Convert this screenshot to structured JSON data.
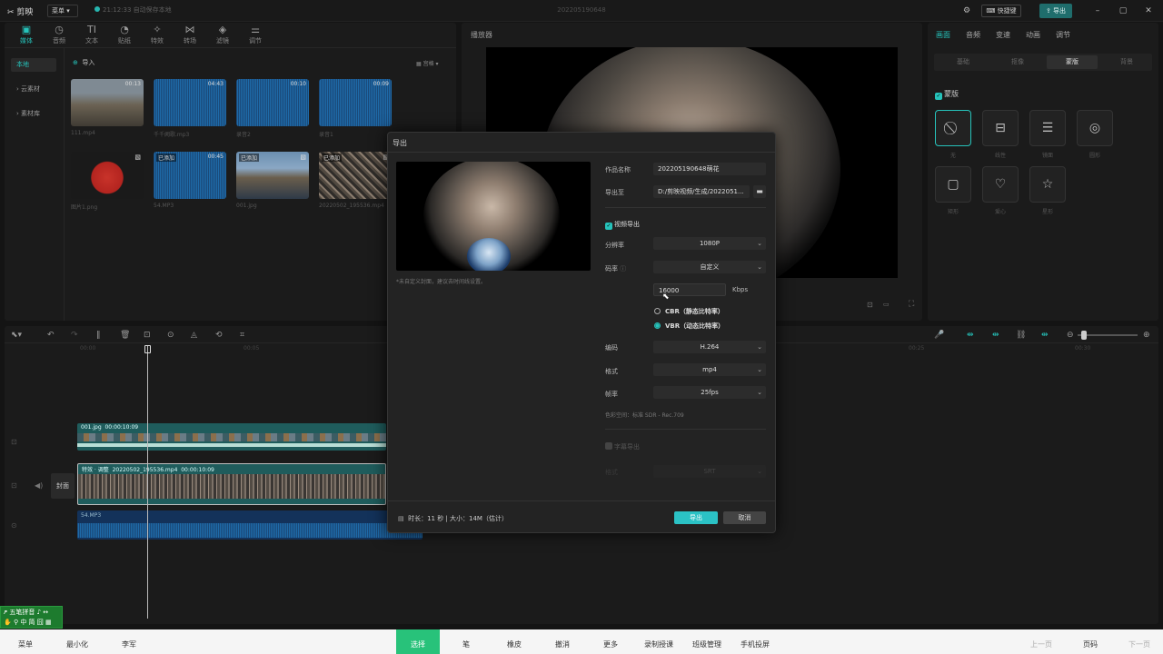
{
  "app": {
    "logo": "剪映",
    "menu": "菜单",
    "autosave": "21:12:33 自动保存本地",
    "project_title": "202205190648",
    "shortcut": "快捷键",
    "export": "导出"
  },
  "toolbar": [
    {
      "label": "媒体",
      "icon": "media-icon",
      "glyph": "▣"
    },
    {
      "label": "音频",
      "icon": "audio-icon",
      "glyph": "◷"
    },
    {
      "label": "文本",
      "icon": "text-icon",
      "glyph": "TI"
    },
    {
      "label": "贴纸",
      "icon": "sticker-icon",
      "glyph": "◔"
    },
    {
      "label": "特效",
      "icon": "effects-icon",
      "glyph": "✧"
    },
    {
      "label": "转场",
      "icon": "transition-icon",
      "glyph": "⋈"
    },
    {
      "label": "滤镜",
      "icon": "filter-icon",
      "glyph": "◈"
    },
    {
      "label": "调节",
      "icon": "adjust-icon",
      "glyph": "⚌"
    }
  ],
  "media_sidebar": [
    "本地",
    "› 云素材",
    "› 素材库"
  ],
  "media": {
    "import": "导入",
    "view": "宫格"
  },
  "media_items": [
    {
      "caption": "111.mp4",
      "duration": "00:13",
      "tag": "",
      "kind": "video"
    },
    {
      "caption": "千千阙歌.mp3",
      "duration": "04:43",
      "tag": "",
      "kind": "audio"
    },
    {
      "caption": "录音2",
      "duration": "00:10",
      "tag": "",
      "kind": "audio"
    },
    {
      "caption": "录音1",
      "duration": "00:09",
      "tag": "",
      "kind": "audio"
    },
    {
      "caption": "图片1.png",
      "duration": "",
      "tag": "",
      "kind": "drum"
    },
    {
      "caption": "54.MP3",
      "duration": "00:45",
      "tag": "已添加",
      "kind": "audio"
    },
    {
      "caption": "001.jpg",
      "duration": "",
      "tag": "已添加",
      "kind": "photo"
    },
    {
      "caption": "20220502_195536.mp4",
      "duration": "",
      "tag": "已添加",
      "kind": "crystal"
    }
  ],
  "player": {
    "title": "播放器"
  },
  "right_panel": {
    "tabs": [
      "画面",
      "音频",
      "变速",
      "动画",
      "调节"
    ],
    "segments": [
      "基础",
      "抠像",
      "蒙版",
      "背景"
    ],
    "mask_title": "蒙版",
    "masks": [
      {
        "label": "无",
        "glyph": "⃠",
        "icon": "none-icon"
      },
      {
        "label": "线性",
        "glyph": "⊟",
        "icon": "linear-mask-icon"
      },
      {
        "label": "镜面",
        "glyph": "☰",
        "icon": "mirror-mask-icon"
      },
      {
        "label": "圆形",
        "glyph": "◎",
        "icon": "circle-mask-icon"
      },
      {
        "label": "矩形",
        "glyph": "▢",
        "icon": "rectangle-mask-icon"
      },
      {
        "label": "爱心",
        "glyph": "♡",
        "icon": "heart-mask-icon"
      },
      {
        "label": "星形",
        "glyph": "☆",
        "icon": "star-mask-icon"
      }
    ]
  },
  "timeline": {
    "ruler": [
      "00:00",
      "00:05",
      "00:25",
      "00:30"
    ],
    "clip1": {
      "name": "001.jpg",
      "duration": "00:00:10:09"
    },
    "clip2": {
      "name": "特效 · 调整",
      "file": "20220502_195536.mp4",
      "duration": "00:00:10:09"
    },
    "cover": "封面",
    "audio_clip": "54.MP3"
  },
  "export_dialog": {
    "title": "导出",
    "cover_note": "*未自定义封面，建议去时间线设置。",
    "name_label": "作品名称",
    "name_value": "202205190648萌花",
    "path_label": "导出至",
    "path_value": "D:/剪映视频/生成/2022051...",
    "video_export": "视频导出",
    "resolution_label": "分辨率",
    "resolution_value": "1080P",
    "bitrate_label": "码率",
    "bitrate_value": "自定义",
    "bitrate_input": "16000",
    "bitrate_unit": "Kbps",
    "cbr_label": "CBR（静态比特率）",
    "vbr_label": "VBR（动态比特率）",
    "codec_label": "编码",
    "codec_value": "H.264",
    "format_label": "格式",
    "format_value": "mp4",
    "framerate_label": "帧率",
    "framerate_value": "25fps",
    "color_space": "色彩空间：标准 SDR - Rec.709",
    "subtitle_export": "字幕导出",
    "subtitle_format_label": "格式",
    "subtitle_format_value": "SRT",
    "info": "时长：11 秒 | 大小：14M（估计）",
    "export_btn": "导出",
    "cancel_btn": "取消"
  },
  "ime": {
    "title": "五笔拼音",
    "tools": "中 简 囧"
  },
  "taskbar": {
    "left": [
      "菜单",
      "最小化",
      "李军"
    ],
    "center": [
      "选择",
      "笔",
      "橡皮",
      "撤消",
      "更多",
      "录制授课",
      "班级管理",
      "手机投屏"
    ],
    "right": [
      "上一页",
      "页码",
      "下一页"
    ]
  }
}
